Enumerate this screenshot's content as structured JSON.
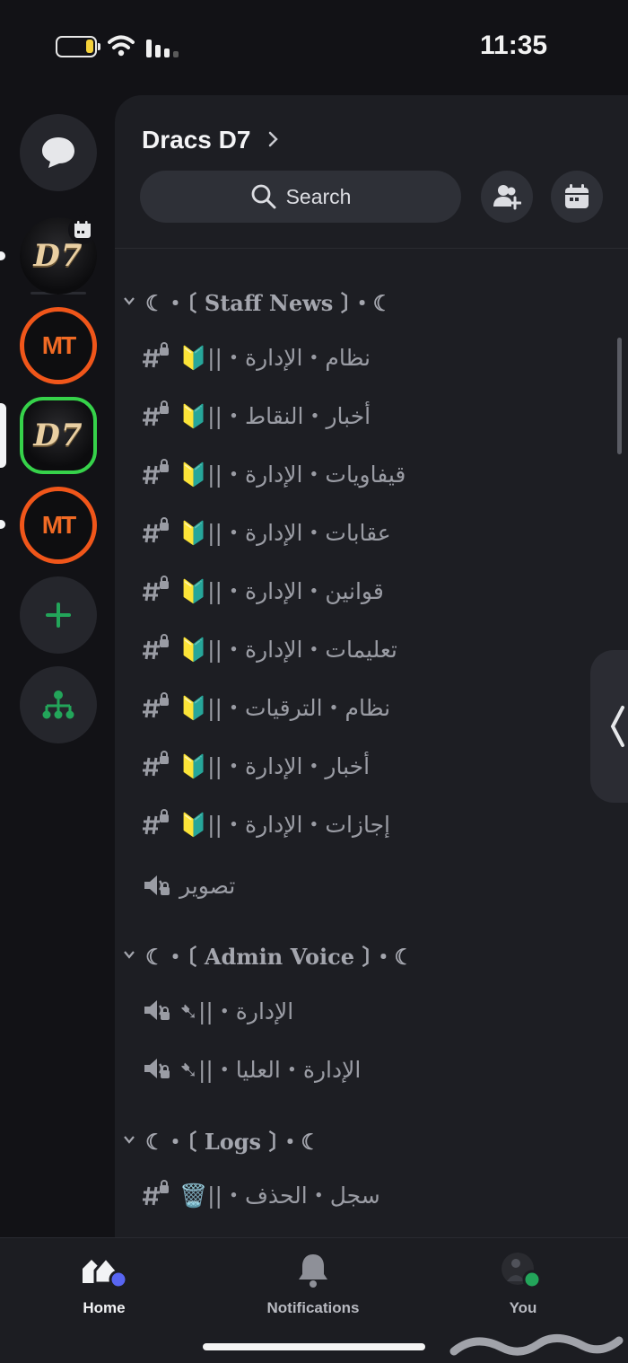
{
  "status_bar": {
    "time": "11:35",
    "battery_color": "#f4d13a"
  },
  "rail": {
    "servers": [
      {
        "label": "D7",
        "style": "d7",
        "unread": true,
        "event_badge": true
      },
      {
        "label": "MT",
        "style": "mt",
        "unread": false
      },
      {
        "label": "D7",
        "style": "d7",
        "selected": true
      },
      {
        "label": "MT",
        "style": "mt",
        "unread": true
      }
    ],
    "add_icon": "plus-icon",
    "discover_icon": "hierarchy-icon",
    "dm_icon": "chat-bubble-icon"
  },
  "panel": {
    "server_name": "Dracs D7",
    "search_label": "Search",
    "invite_icon": "add-member-icon",
    "events_icon": "calendar-icon"
  },
  "categories": [
    {
      "label": "☾・〔 Staff News 〕・☾",
      "channels": [
        {
          "type": "text-locked",
          "name": "نظام・الإدارة・||🔰"
        },
        {
          "type": "text-locked",
          "name": "أخبار・النقاط・||🔰"
        },
        {
          "type": "text-locked",
          "name": "قيفاويات・الإدارة・||🔰"
        },
        {
          "type": "text-locked",
          "name": "عقابات・الإدارة・||🔰"
        },
        {
          "type": "text-locked",
          "name": "قوانين・الإدارة・||🔰"
        },
        {
          "type": "text-locked",
          "name": "تعليمات・الإدارة・||🔰"
        },
        {
          "type": "text-locked",
          "name": "نظام・الترقيات・||🔰"
        },
        {
          "type": "text-locked",
          "name": "أخبار・الإدارة・||🔰"
        },
        {
          "type": "text-locked",
          "name": "إجازات・الإدارة・||🔰"
        },
        {
          "type": "voice-locked",
          "name": "تصوير"
        }
      ]
    },
    {
      "label": "☾・〔 Admin Voice 〕・☾",
      "channels": [
        {
          "type": "voice-locked",
          "name": "الإدارة・||➷"
        },
        {
          "type": "voice-locked",
          "name": "الإدارة・العليا・||➷"
        }
      ]
    },
    {
      "label": "☾・〔 Logs 〕・☾",
      "channels": [
        {
          "type": "text-locked",
          "name": "سجل・الحذف・||🗑️"
        }
      ]
    }
  ],
  "nav": {
    "items": [
      {
        "label": "Home",
        "active": true
      },
      {
        "label": "Notifications",
        "active": false
      },
      {
        "label": "You",
        "active": false
      }
    ],
    "home_badge_color": "#5865f2",
    "status_color": "#23a55a"
  }
}
